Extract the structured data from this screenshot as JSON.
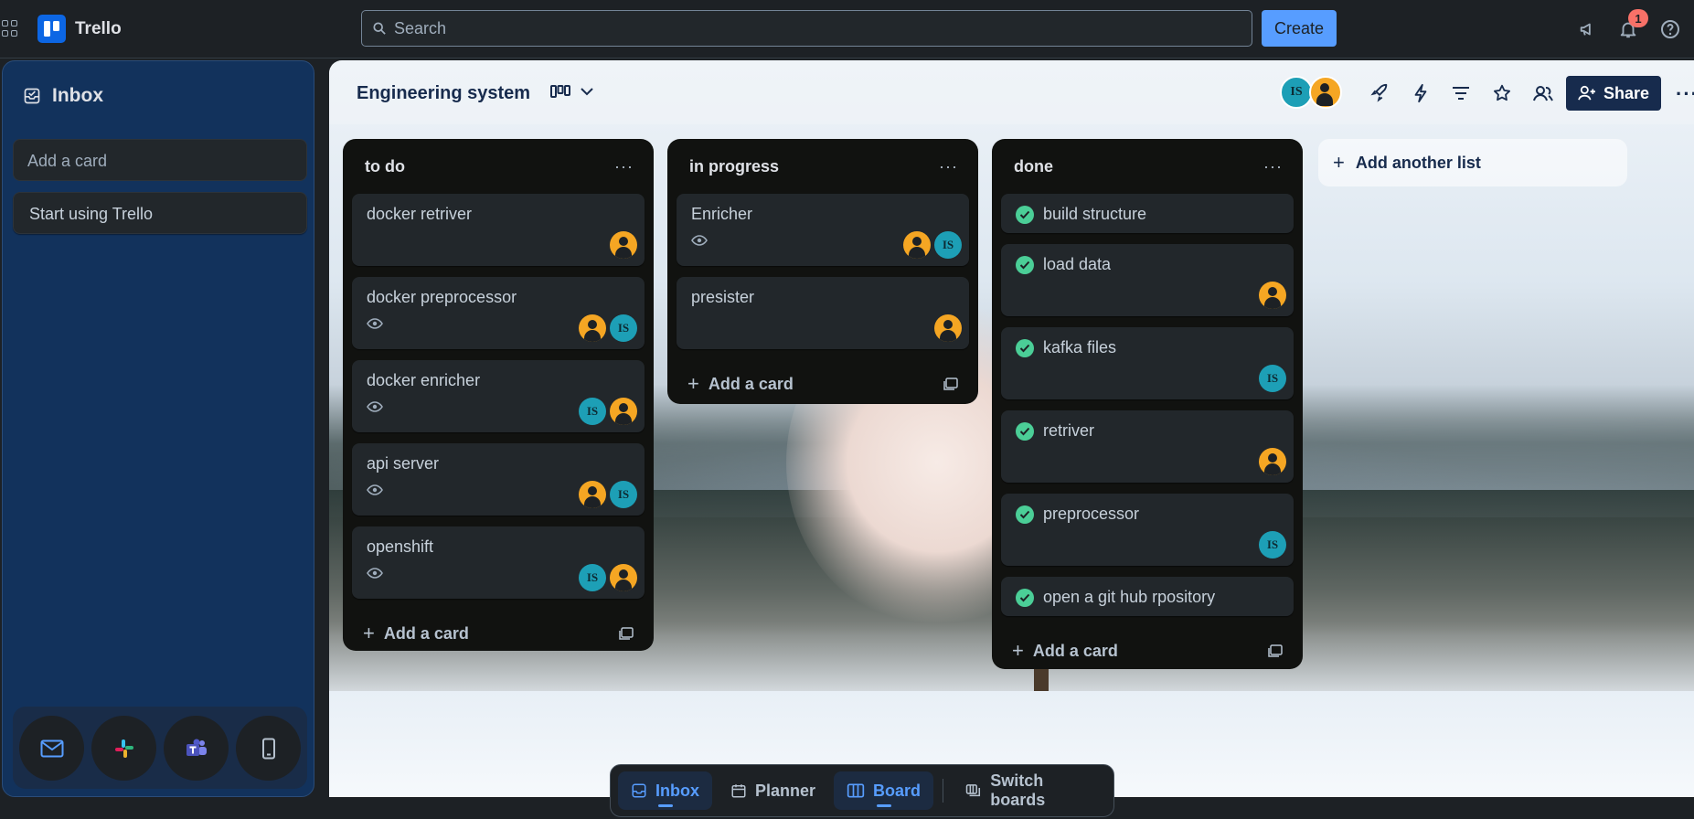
{
  "app": {
    "name": "Trello"
  },
  "topbar": {
    "search_placeholder": "Search",
    "create_label": "Create",
    "notifications_count": "1"
  },
  "inbox": {
    "title": "Inbox",
    "add_card_placeholder": "Add a card",
    "cards": [
      "Start using Trello"
    ]
  },
  "board": {
    "title": "Engineering system",
    "share_label": "Share",
    "members": [
      "IS",
      "user"
    ],
    "add_list_label": "Add another list",
    "lists": [
      {
        "title": "to do",
        "add_label": "Add a card",
        "cards": [
          {
            "title": "docker retriver",
            "watch": false,
            "avatars": [
              "user"
            ]
          },
          {
            "title": "docker preprocessor",
            "watch": true,
            "avatars": [
              "user",
              "IS"
            ]
          },
          {
            "title": "docker enricher",
            "watch": true,
            "avatars": [
              "IS",
              "user"
            ]
          },
          {
            "title": "api server",
            "watch": true,
            "avatars": [
              "user",
              "IS"
            ]
          },
          {
            "title": "openshift",
            "watch": true,
            "avatars": [
              "IS",
              "user"
            ]
          }
        ]
      },
      {
        "title": "in progress",
        "add_label": "Add a card",
        "cards": [
          {
            "title": "Enricher",
            "watch": true,
            "avatars": [
              "user",
              "IS"
            ]
          },
          {
            "title": "presister",
            "watch": false,
            "avatars": [
              "user"
            ]
          }
        ]
      },
      {
        "title": "done",
        "add_label": "Add a card",
        "cards": [
          {
            "title": "build structure",
            "done": true,
            "avatars": []
          },
          {
            "title": "load data",
            "done": true,
            "avatars": [
              "user"
            ]
          },
          {
            "title": "kafka files",
            "done": true,
            "avatars": [
              "IS"
            ]
          },
          {
            "title": "retriver",
            "done": true,
            "avatars": [
              "user"
            ]
          },
          {
            "title": "preprocessor",
            "done": true,
            "avatars": [
              "IS"
            ]
          },
          {
            "title": "open a git hub rpository",
            "done": true,
            "avatars": []
          }
        ]
      }
    ]
  },
  "bottom_nav": {
    "items": [
      {
        "label": "Inbox",
        "icon": "inbox-icon",
        "active": true
      },
      {
        "label": "Planner",
        "icon": "calendar-icon",
        "active": false
      },
      {
        "label": "Board",
        "icon": "board-icon",
        "active": true
      },
      {
        "label": "Switch boards",
        "icon": "switch-boards-icon",
        "active": false
      }
    ]
  },
  "dock_apps": [
    "mail-icon",
    "slack-icon",
    "teams-icon",
    "mobile-icon"
  ],
  "colors": {
    "accent": "#579dff",
    "inbox_bg": "#12325c",
    "done_check": "#4bce97",
    "avatar_is": "#1d9fb6",
    "avatar_user": "#f5a623"
  }
}
